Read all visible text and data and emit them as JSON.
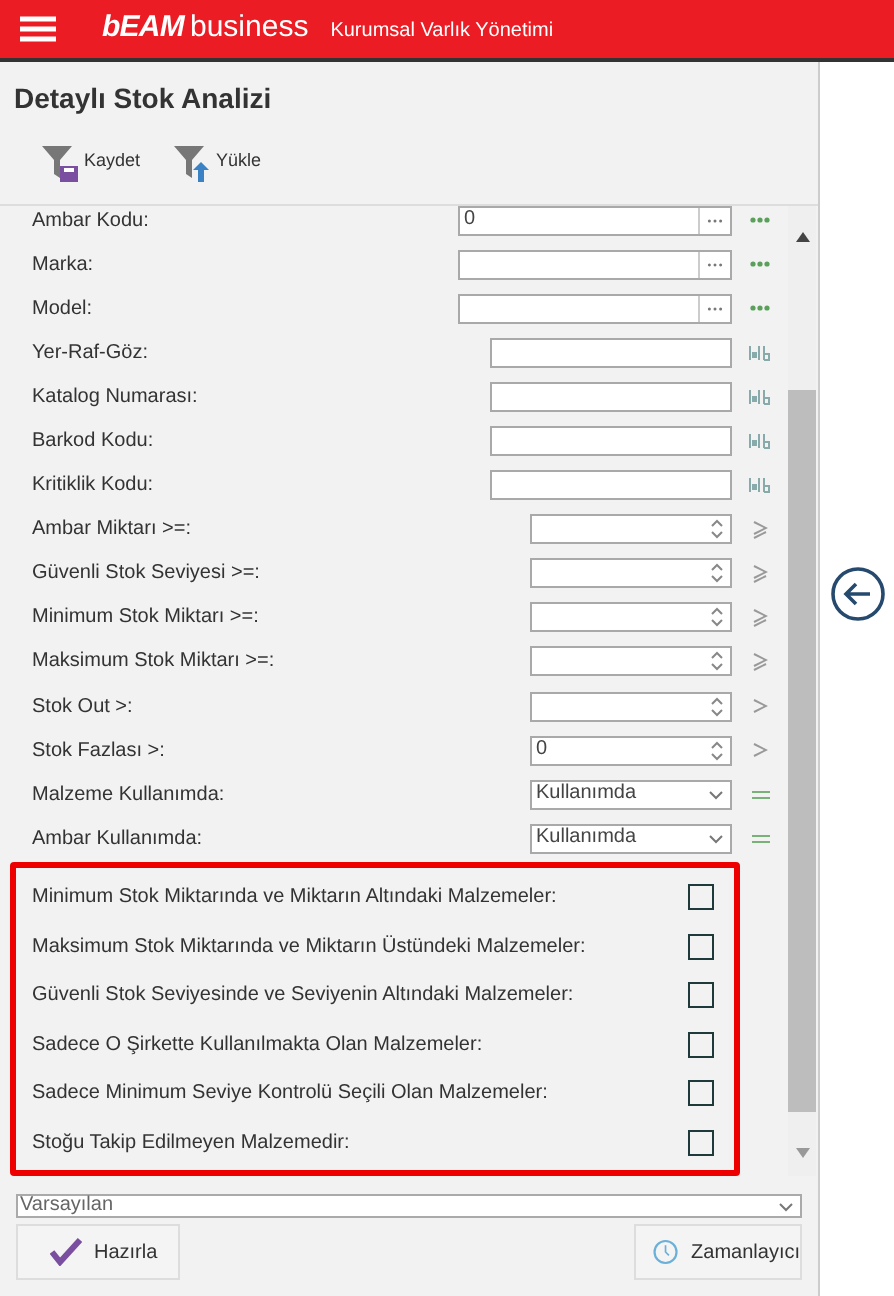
{
  "header": {
    "brand_main": "bEAM",
    "brand_sub": "business",
    "subtitle": "Kurumsal Varlık Yönetimi"
  },
  "page_title": "Detaylı Stok Analizi",
  "toolbar": [
    {
      "kind": "save",
      "label": "Kaydet"
    },
    {
      "kind": "load",
      "label": "Yükle"
    }
  ],
  "fields": [
    {
      "kind": "lookup",
      "label": "Ambar Kodu:",
      "value": "0"
    },
    {
      "kind": "lookup",
      "label": "Marka:"
    },
    {
      "kind": "lookup",
      "label": "Model:"
    },
    {
      "kind": "text",
      "label": "Yer-Raf-Göz:"
    },
    {
      "kind": "text",
      "label": "Katalog Numarası:"
    },
    {
      "kind": "text",
      "label": "Barkod Kodu:"
    },
    {
      "kind": "text",
      "label": "Kritiklik Kodu:"
    },
    {
      "kind": "atleast",
      "label": "Ambar Miktarı >=:"
    },
    {
      "kind": "atleast",
      "label": "Güvenli Stok Seviyesi >=:"
    },
    {
      "kind": "atleast",
      "label": "Minimum Stok Miktarı >=:"
    },
    {
      "kind": "atleast",
      "label": "Maksimum Stok Miktarı >=:"
    },
    {
      "kind": "above",
      "label": "Stok Out >:"
    },
    {
      "kind": "above",
      "label": "Stok Fazlası >:",
      "value": "0"
    },
    {
      "kind": "select",
      "label": "Malzeme Kullanımda:",
      "value": "Kullanımda"
    },
    {
      "kind": "select",
      "label": "Ambar Kullanımda:",
      "value": "Kullanımda"
    }
  ],
  "checks": [
    {
      "label": "Minimum Stok Miktarında ve Miktarın Altındaki Malzemeler:",
      "checked": false
    },
    {
      "label": "Maksimum Stok Miktarında ve Miktarın Üstündeki Malzemeler:",
      "checked": false
    },
    {
      "label": "Güvenli Stok Seviyesinde ve Seviyenin Altındaki Malzemeler:",
      "checked": false
    },
    {
      "label": "Sadece O Şirkette Kullanılmakta Olan Malzemeler:",
      "checked": false
    },
    {
      "label": "Sadece Minimum Seviye Kontrolü Seçili Olan Malzemeler:",
      "checked": false
    },
    {
      "label": "Stoğu Takip Edilmeyen Malzemedir:",
      "checked": false
    }
  ],
  "preset": {
    "value": "Varsayılan"
  },
  "buttons": [
    {
      "kind": "prepare",
      "label": "Hazırla"
    },
    {
      "kind": "schedule",
      "label": "Zamanlayıcı"
    }
  ]
}
